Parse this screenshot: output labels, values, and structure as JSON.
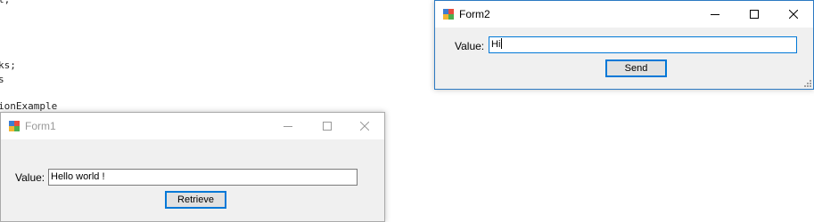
{
  "background_code": {
    "lines": [
      "l;",
      "ks;",
      "s",
      "ionExample"
    ]
  },
  "form1": {
    "title": "Form1",
    "value_label": "Value:",
    "value_text": "Hello world !",
    "button_label": "Retrieve"
  },
  "form2": {
    "title": "Form2",
    "value_label": "Value:",
    "value_text": "Hi",
    "button_label": "Send"
  },
  "colors": {
    "accent": "#0078d7",
    "window_bg": "#f0f0f0",
    "titlebar_bg": "#ffffff"
  },
  "icons": [
    "app-icon",
    "minimize-icon",
    "maximize-icon",
    "close-icon",
    "resize-grip-icon"
  ]
}
